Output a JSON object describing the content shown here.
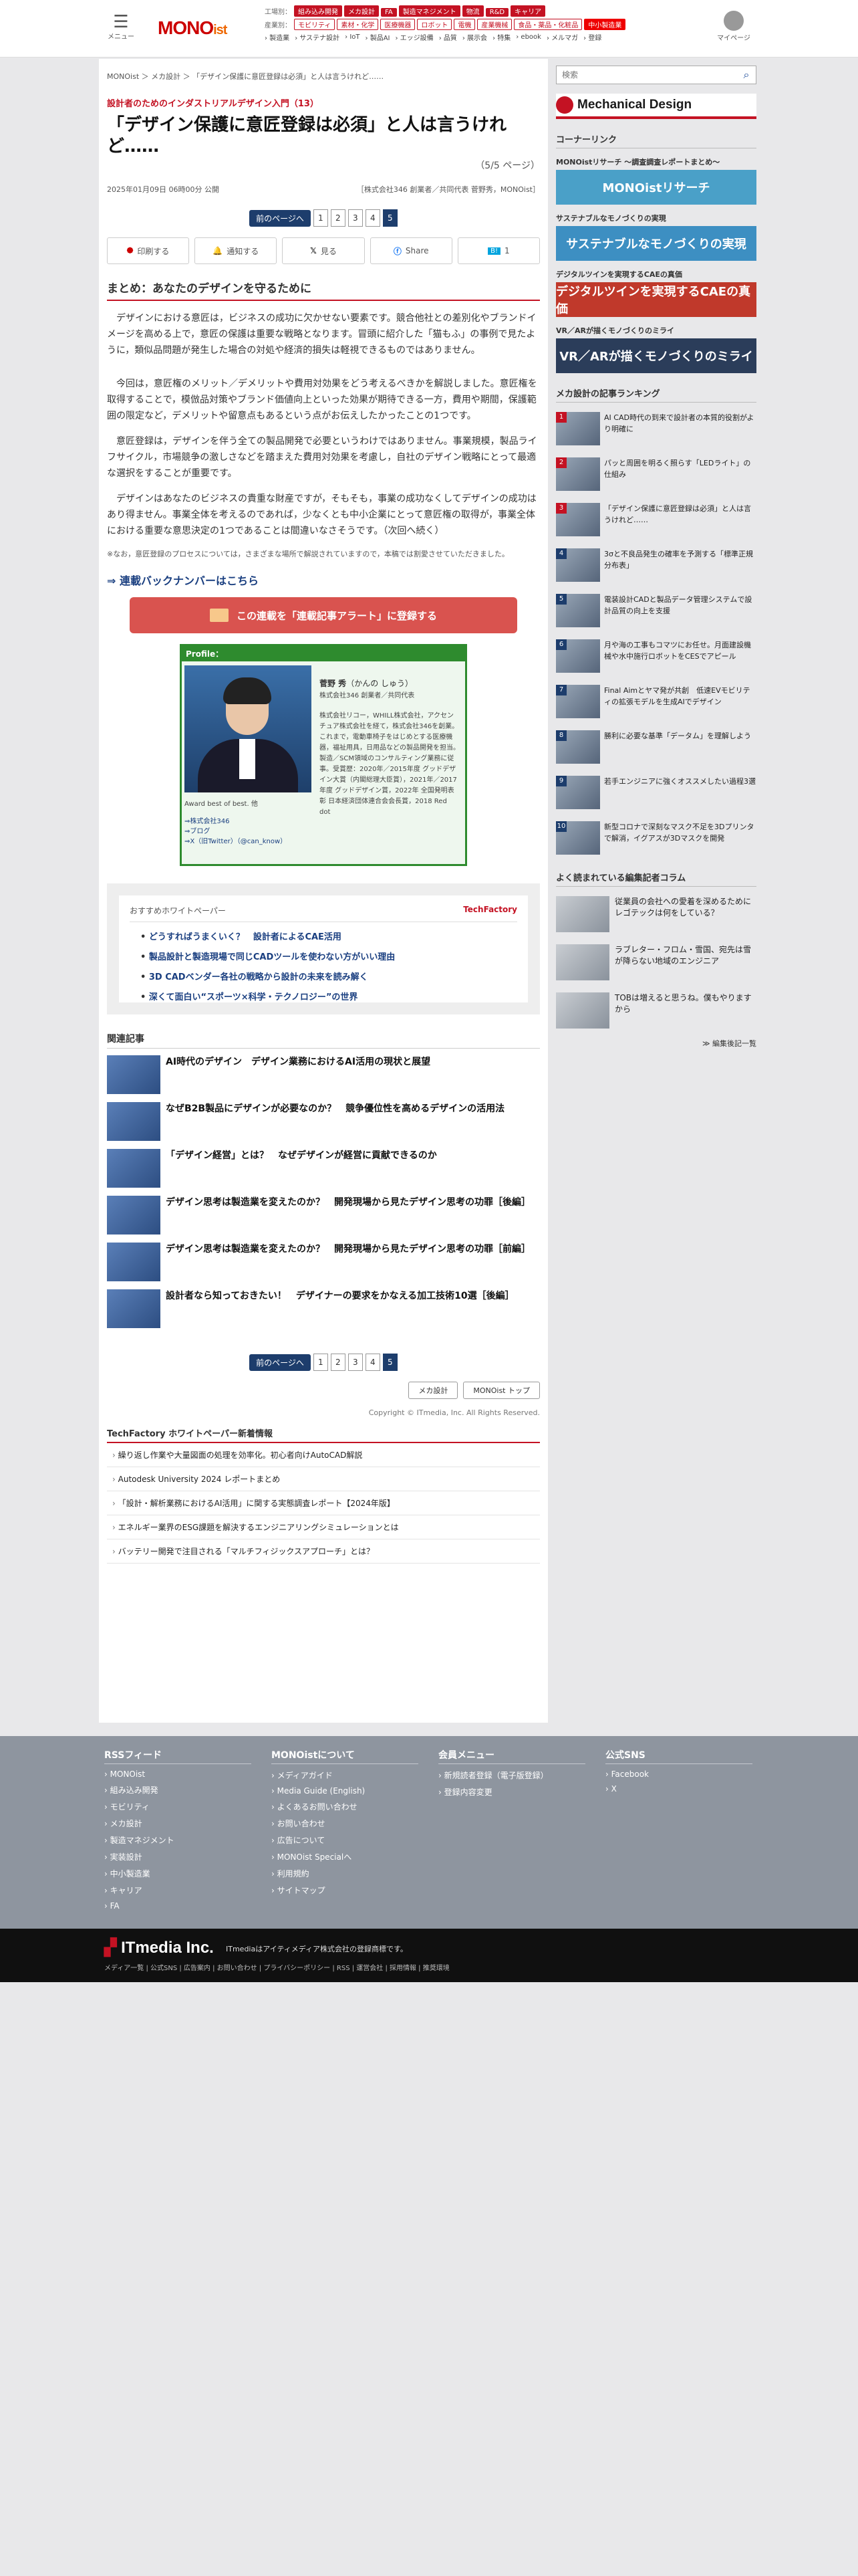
{
  "header": {
    "menu_label": "メニュー",
    "logo_main": "MONO",
    "logo_ist": "ist",
    "mypage_label": "マイページ",
    "row1_label": "工場別：",
    "row1_tags": [
      "組み込み開発",
      "メカ設計",
      "FA",
      "製造マネジメント",
      "物流",
      "R&D",
      "キャリア"
    ],
    "row2_label": "産業別：",
    "row2_tags": [
      "モビリティ",
      "素材・化学",
      "医療機器",
      "ロボット",
      "電機",
      "産業機械",
      "食品・薬品・化粧品"
    ],
    "row2_special": "中小製造業",
    "subnav": [
      "› 製造業",
      "› サステナ設計",
      "› IoT",
      "› 製品AI",
      "› エッジ設備",
      "› 品質",
      "› 展示会",
      "› 特集",
      "› ebook",
      "› メルマガ",
      "› 登録"
    ]
  },
  "breadcrumb": "MONOist ＞ メカ設計 ＞ 「デザイン保護に意匠登録は必須」と人は言うけれど……",
  "article": {
    "series": "設計者のためのインダストリアルデザイン入門（13）",
    "title": "「デザイン保護に意匠登録は必須」と人は言うけれど……",
    "page_of": "（5/5 ページ）",
    "date": "2025年01月09日 06時00分 公開",
    "author": "［株式会社346 創業者／共同代表 菅野秀，MONOist］",
    "summary_heading": "まとめ：あなたのデザインを守るために",
    "paras": [
      "デザインにおける意匠は，ビジネスの成功に欠かせない要素です。競合他社との差別化やブランドイメージを高める上で，意匠の保護は重要な戦略となります。冒頭に紹介した「猫もふ」の事例で見たように，類似品問題が発生した場合の対処や経済的損失は軽視できるものではありません。",
      "今回は，意匠権のメリット／デメリットや費用対効果をどう考えるべきかを解説しました。意匠権を取得することで，模倣品対策やブランド価値向上といった効果が期待できる一方，費用や期間，保護範囲の限定など，デメリットや留意点もあるという点がお伝えしたかったことの1つです。",
      "意匠登録は，デザインを伴う全ての製品開発で必要というわけではありません。事業規模，製品ライフサイクル，市場競争の激しさなどを踏まえた費用対効果を考慮し，自社のデザイン戦略にとって最適な選択をすることが重要です。",
      "デザインはあなたのビジネスの貴重な財産ですが，そもそも，事業の成功なくしてデザインの成功はあり得ません。事業全体を考えるのであれば，少なくとも中小企業にとって意匠権の取得が，事業全体における重要な意思決定の1つであることは間違いなさそうです。（次回へ続く）"
    ],
    "note": "※なお，意匠登録のプロセスについては，さまざまな場所で解説されていますので，本稿では割愛させていただきました。",
    "backnumber": "⇒ 連載バックナンバーはこちら",
    "alert_btn": "この連載を「連載記事アラート」に登録する"
  },
  "pager": {
    "prev": "前のページへ",
    "pages": [
      "1",
      "2",
      "3",
      "4",
      "5"
    ],
    "current": "5"
  },
  "share": {
    "print": "印刷する",
    "mail": "通知する",
    "x": "見る",
    "facebook": "Share",
    "hatena": "1"
  },
  "profile": {
    "header": "Profile：",
    "name": "菅野 秀",
    "kana": "（かんの しゅう）",
    "role": "株式会社346 創業者／共同代表",
    "desc": "株式会社リコー，WHILL株式会社，アクセンチュア株式会社を経て，株式会社346を創業。これまで，電動車椅子をはじめとする医療機器，福祉用具，日用品などの製品開発を担当。製造／SCM領域のコンサルティング業務に従事。受賞歴：2020年／2015年度 グッドデザイン大賞（内閣総理大臣賞），2021年／2017年度 グッドデザイン賞，2022年 全国発明表彰 日本経済団体連合会会長賞，2018 Red dot",
    "award": "Award best of best. 他",
    "links": [
      "⇒株式会社346",
      "⇒ブログ",
      "⇒X（旧Twitter）（@can_know）"
    ]
  },
  "whitepaper": {
    "title": "おすすめホワイトペーパー",
    "brand": "TechFactory",
    "items": [
      "どうすればうまくいく？　設計者によるCAE活用",
      "製品設計と製造現場で同じCADツールを使わない方がいい理由",
      "3D CADベンダー各社の戦略から設計の未来を読み解く",
      "深くて面白い“スポーツ×科学・テクノロジー”の世界"
    ]
  },
  "related": {
    "heading": "関連記事",
    "items": [
      "AI時代のデザイン　デザイン業務におけるAI活用の現状と展望",
      "なぜB2B製品にデザインが必要なのか？　競争優位性を高めるデザインの活用法",
      "「デザイン経営」とは？　なぜデザインが経営に貢献できるのか",
      "デザイン思考は製造業を変えたのか？　開発現場から見たデザイン思考の功罪［後編］",
      "デザイン思考は製造業を変えたのか？　開発現場から見たデザイン思考の功罪［前編］",
      "設計者なら知っておきたい！　デザイナーの要求をかなえる加工技術10選［後編］"
    ]
  },
  "bottom": {
    "btn_mech": "メカ設計",
    "btn_top": "MONOist トップ",
    "copyright": "Copyright © ITmedia, Inc. All Rights Reserved.",
    "tf_heading": "TechFactory ホワイトペーパー新着情報",
    "tf_items": [
      "繰り返し作業や大量図面の処理を効率化。初心者向けAutoCAD解説",
      "Autodesk University 2024 レポートまとめ",
      "「設計・解析業務におけるAI活用」に関する実態調査レポート【2024年版】",
      "エネルギー業界のESG課題を解決するエンジニアリングシミュレーションとは",
      "バッテリー開発で注目される「マルチフィジックスアプローチ」とは？"
    ]
  },
  "sidebar": {
    "search_placeholder": "検索",
    "md_banner": "Mechanical Design",
    "corner_heading": "コーナーリンク",
    "corners": [
      {
        "title": "MONOistリサーチ ～調査調査レポートまとめ～",
        "banner": "MONOistリサーチ",
        "color": "#4aa0c8"
      },
      {
        "title": "サステナブルなモノづくりの実現",
        "banner": "サステナブルなモノづくりの実現",
        "color": "#3d8fc2"
      },
      {
        "title": "デジタルツインを実現するCAEの真価",
        "banner": "デジタルツインを実現するCAEの真価",
        "color": "#c0392b"
      },
      {
        "title": "VR／ARが描くモノづくりのミライ",
        "banner": "VR／ARが描くモノづくりのミライ",
        "color": "#2b3d5a"
      }
    ],
    "ranking_heading": "メカ設計の記事ランキング",
    "ranking": [
      "AI CAD時代の到来で設計者の本質的役割がより明確に",
      "パッと周囲を明るく照らす「LEDライト」の仕組み",
      "「デザイン保護に意匠登録は必須」と人は言うけれど……",
      "3σと不良品発生の確率を予測する「標準正規分布表」",
      "電装設計CADと製品データ管理システムで設計品質の向上を支援",
      "月や海の工事もコマツにお任せ。月面建設機械や水中施行ロボットをCESでアピール",
      "Final Aimとヤマ発が共創　低速EVモビリティの拡張モデルを生成AIでデザイン",
      "勝利に必要な基準「データム」を理解しよう",
      "若手エンジニアに強くオススメしたい過程3選",
      "新型コロナで深刻なマスク不足を3Dプリンタで解消，イグアスが3Dマスクを開発"
    ],
    "editorial_heading": "よく読まれている編集記者コラム",
    "editorial": [
      "従業員の会社への愛着を深めるためにレゴテックは何をしている？",
      "ラブレター・フロム・雪国、宛先は雪が降らない地域のエンジニア",
      "TOBは増えると思うね。僕もやりますから"
    ],
    "editorial_list": "≫ 編集後記一覧"
  },
  "footer": {
    "cols": [
      {
        "heading": "RSSフィード",
        "items": [
          "MONOist",
          "組み込み開発",
          "モビリティ",
          "メカ設計",
          "製造マネジメント",
          "実装設計",
          "中小製造業",
          "キャリア",
          "FA"
        ]
      },
      {
        "heading": "MONOistについて",
        "items": [
          "メディアガイド",
          "Media Guide (English)",
          "よくあるお問い合わせ",
          "お問い合わせ",
          "広告について",
          "MONOist Specialへ",
          "利用規約",
          "サイトマップ"
        ]
      },
      {
        "heading": "会員メニュー",
        "items": [
          "新規読者登録（電子版登録）",
          "登録内容変更"
        ]
      },
      {
        "heading": "公式SNS",
        "items": [
          "Facebook",
          "X"
        ]
      }
    ],
    "itm_logo": "ITmedia Inc.",
    "itm_reg": "ITmediaはアイティメディア株式会社の登録商標です。",
    "itm_links": "メディア一覧 | 公式SNS | 広告案内 | お問い合わせ | プライバシーポリシー | RSS | 運営会社 | 採用情報 | 推奨環境"
  }
}
